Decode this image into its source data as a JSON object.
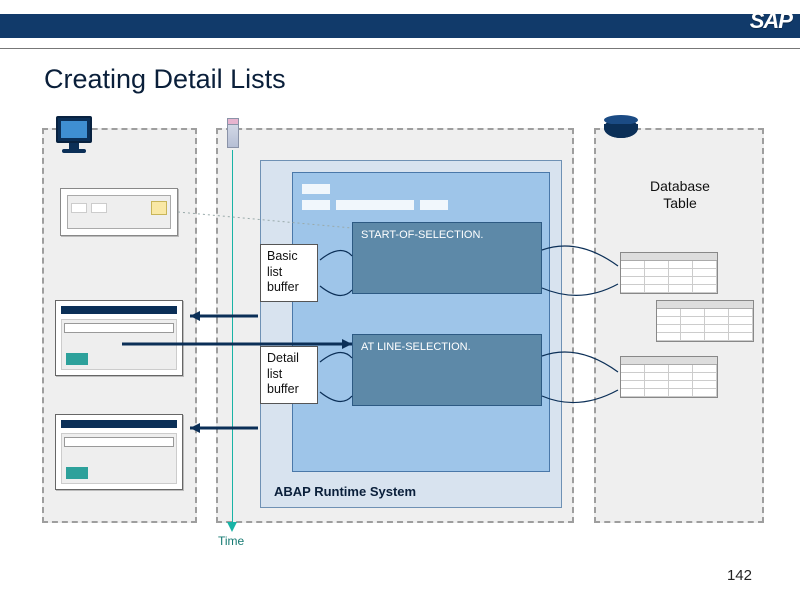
{
  "header": {
    "logo_text": "SAP"
  },
  "title": "Creating Detail Lists",
  "page_number": "142",
  "time_axis_label": "Time",
  "buffers": {
    "basic": "Basic\nlist\nbuffer",
    "detail": "Detail\nlist\nbuffer"
  },
  "events": {
    "start_of_selection": "START-OF-SELECTION.",
    "at_line_selection": "AT LINE-SELECTION."
  },
  "runtime_label": "ABAP Runtime System",
  "right_panel": {
    "db_table_label": "Database\nTable"
  }
}
